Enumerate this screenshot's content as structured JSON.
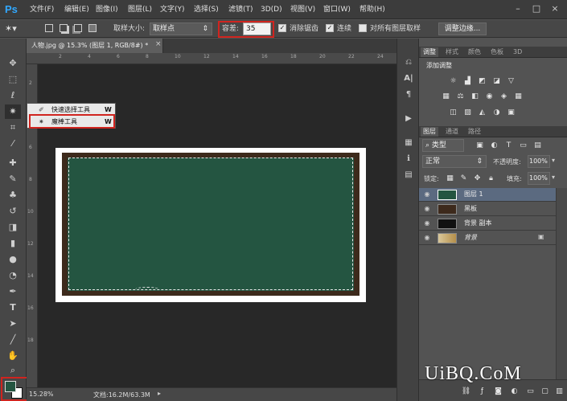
{
  "app": {
    "logo": "Ps"
  },
  "menu": [
    "文件(F)",
    "编辑(E)",
    "图像(I)",
    "图层(L)",
    "文字(Y)",
    "选择(S)",
    "滤镜(T)",
    "3D(D)",
    "视图(V)",
    "窗口(W)",
    "帮助(H)"
  ],
  "window_controls": [
    "–",
    "□",
    "×"
  ],
  "options": {
    "sample_size_label": "取样大小:",
    "sample_size_value": "取样点",
    "tolerance_label": "容差:",
    "tolerance_value": "35",
    "antialias_label": "消除锯齿",
    "contiguous_label": "连续",
    "sample_all_label": "对所有图层取样",
    "refine_edge_label": "调整边缘..."
  },
  "document": {
    "tab_title": "人物.jpg @ 15.3% (图层 1, RGB/8#) *",
    "tab_close": "×",
    "zoom": "15.28%",
    "doc_info": "文档:16.2M/63.3M"
  },
  "ruler_top": [
    "2",
    "4",
    "6",
    "8",
    "10",
    "12",
    "14",
    "16",
    "18",
    "20",
    "22",
    "24"
  ],
  "ruler_left": [
    "2",
    "4",
    "6",
    "8",
    "10",
    "12",
    "14",
    "16",
    "18"
  ],
  "flyout": {
    "items": [
      {
        "label": "快速选择工具",
        "key": "W"
      },
      {
        "label": "魔棒工具",
        "key": "W"
      }
    ]
  },
  "adjustments_panel": {
    "tabs": [
      "调整",
      "样式",
      "颜色",
      "色板",
      "3D"
    ],
    "title": "添加调整"
  },
  "layers_panel": {
    "tabs": [
      "图层",
      "通道",
      "路径"
    ],
    "filter_kind": "类型",
    "blend_mode": "正常",
    "opacity_label": "不透明度:",
    "opacity_value": "100%",
    "lock_label": "锁定:",
    "fill_label": "填充:",
    "fill_value": "100%",
    "layers": [
      {
        "name": "图层 1",
        "selected": true
      },
      {
        "name": "黑板",
        "selected": false
      },
      {
        "name": "背景 副本",
        "selected": false
      },
      {
        "name": "背景",
        "selected": false,
        "locked": true
      }
    ]
  },
  "watermark": "UiBQ.CoM",
  "colors": {
    "foreground": "#245541",
    "background": "#ffffff",
    "highlight": "#d0241f"
  }
}
